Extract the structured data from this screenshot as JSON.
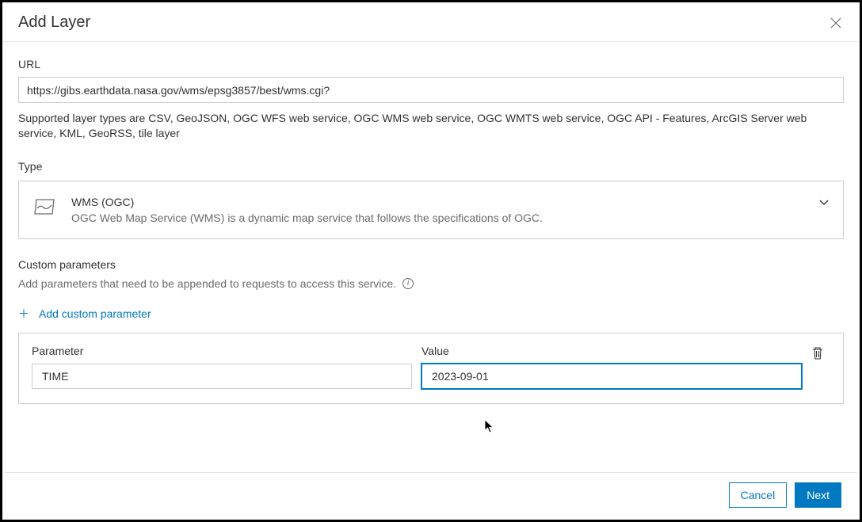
{
  "dialog": {
    "title": "Add Layer"
  },
  "url": {
    "label": "URL",
    "value": "https://gibs.earthdata.nasa.gov/wms/epsg3857/best/wms.cgi?",
    "supported_text": "Supported layer types are CSV, GeoJSON, OGC WFS web service, OGC WMS web service, OGC WMTS web service, OGC API - Features, ArcGIS Server web service, KML, GeoRSS, tile layer"
  },
  "type": {
    "label": "Type",
    "selected_name": "WMS (OGC)",
    "selected_desc": "OGC Web Map Service (WMS) is a dynamic map service that follows the specifications of OGC."
  },
  "custom_params": {
    "label": "Custom parameters",
    "help": "Add parameters that need to be appended to requests to access this service.",
    "add_label": "Add custom parameter",
    "columns": {
      "parameter": "Parameter",
      "value": "Value"
    },
    "rows": [
      {
        "parameter": "TIME",
        "value": "2023-09-01"
      }
    ]
  },
  "footer": {
    "cancel": "Cancel",
    "next": "Next"
  }
}
